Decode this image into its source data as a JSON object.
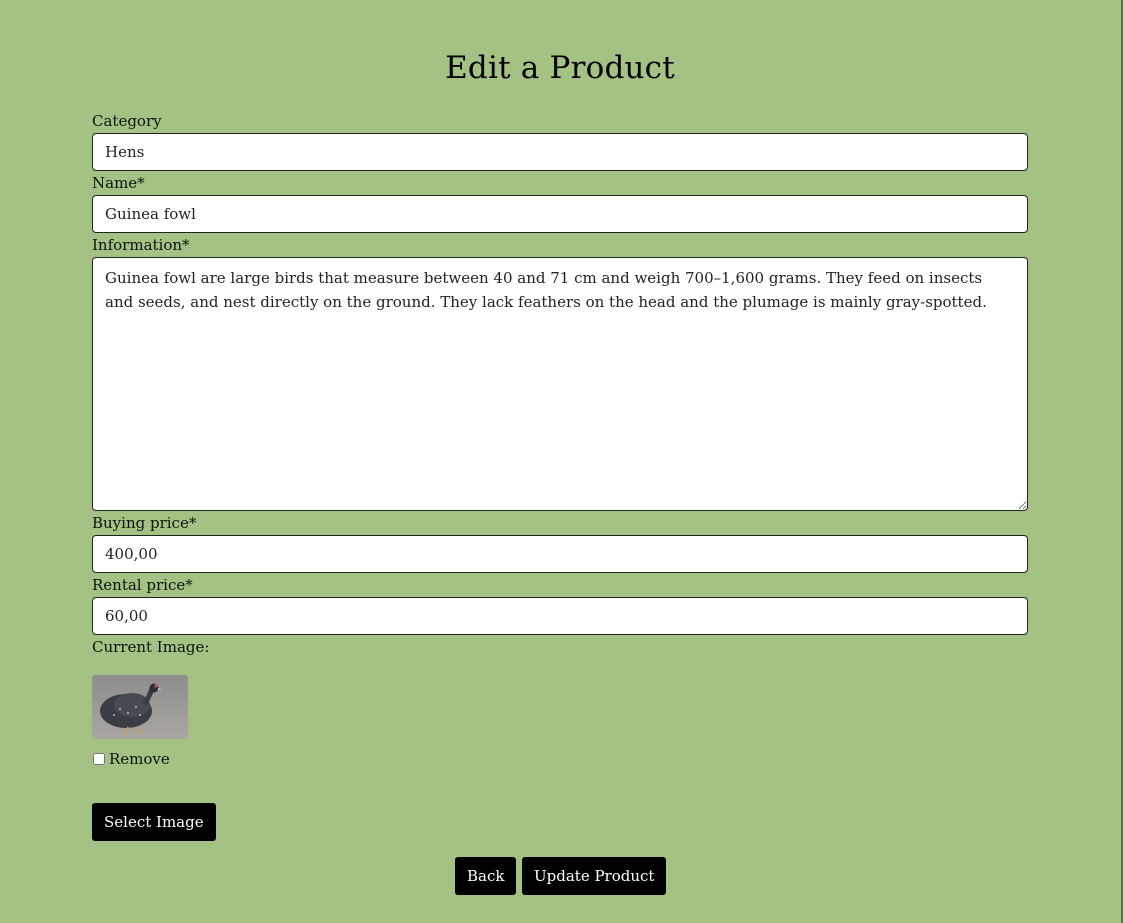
{
  "page": {
    "title": "Edit a Product"
  },
  "form": {
    "category": {
      "label": "Category",
      "value": "Hens"
    },
    "name": {
      "label": "Name*",
      "value": "Guinea fowl"
    },
    "information": {
      "label": "Information*",
      "value": "Guinea fowl are large birds that measure between 40 and 71 cm and weigh 700–1,600 grams. They feed on insects and seeds, and nest directly on the ground. They lack feathers on the head and the plumage is mainly gray-spotted."
    },
    "buying_price": {
      "label": "Buying price*",
      "value": "400,00"
    },
    "rental_price": {
      "label": "Rental price*",
      "value": "60,00"
    },
    "current_image": {
      "label": "Current Image:",
      "remove_label": "Remove",
      "remove_checked": false
    },
    "select_image_label": "Select Image"
  },
  "actions": {
    "back_label": "Back",
    "update_label": "Update Product"
  },
  "colors": {
    "background": "#a4c284",
    "button": "#000000",
    "button_text": "#ffffff"
  }
}
